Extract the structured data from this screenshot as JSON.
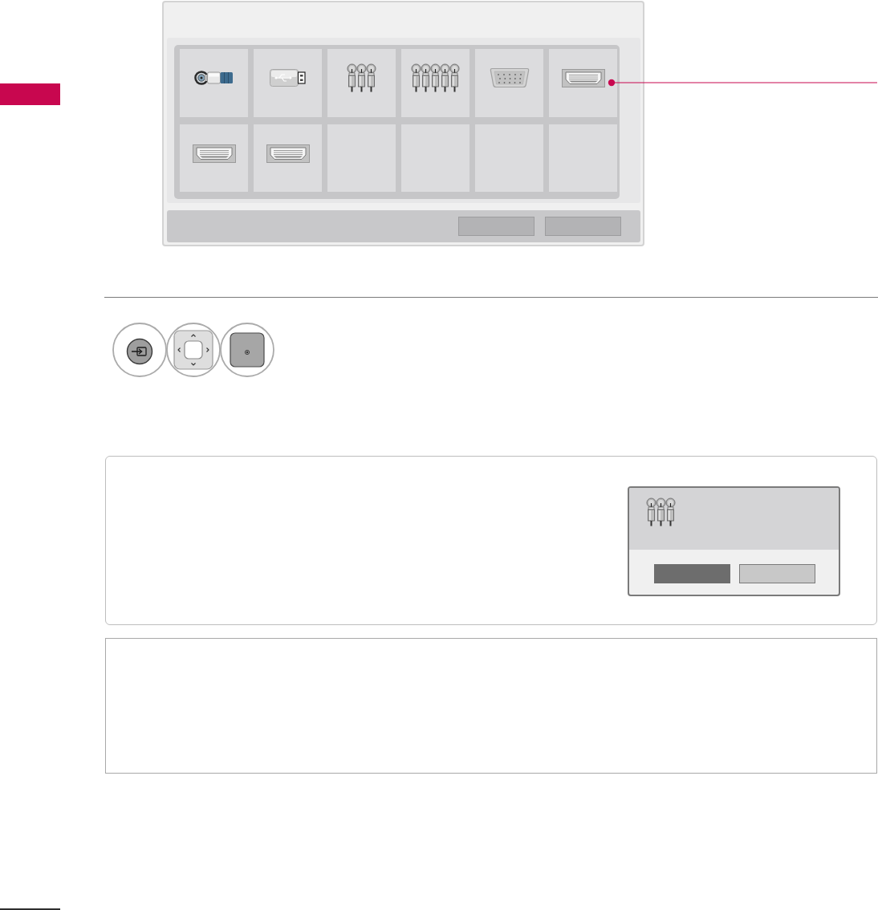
{
  "input_list": {
    "tiles": [
      {
        "kind": "antenna",
        "marked": false
      },
      {
        "kind": "usb",
        "marked": false
      },
      {
        "kind": "av",
        "marked": false
      },
      {
        "kind": "component",
        "marked": false
      },
      {
        "kind": "rgb",
        "marked": false
      },
      {
        "kind": "hdmi",
        "marked": true
      },
      {
        "kind": "hdmi",
        "marked": false
      },
      {
        "kind": "hdmi",
        "marked": false
      },
      {
        "kind": "empty",
        "marked": false
      },
      {
        "kind": "empty",
        "marked": false
      },
      {
        "kind": "empty",
        "marked": false
      },
      {
        "kind": "empty",
        "marked": false
      }
    ],
    "buttons": [
      {
        "selected": false
      },
      {
        "selected": false
      }
    ]
  },
  "remote_keys": [
    {
      "kind": "input"
    },
    {
      "kind": "navigation"
    },
    {
      "kind": "ok"
    }
  ],
  "confirm_dialog": {
    "source": {
      "kind": "av"
    },
    "buttons": [
      {
        "selected": true
      },
      {
        "selected": false
      }
    ]
  }
}
